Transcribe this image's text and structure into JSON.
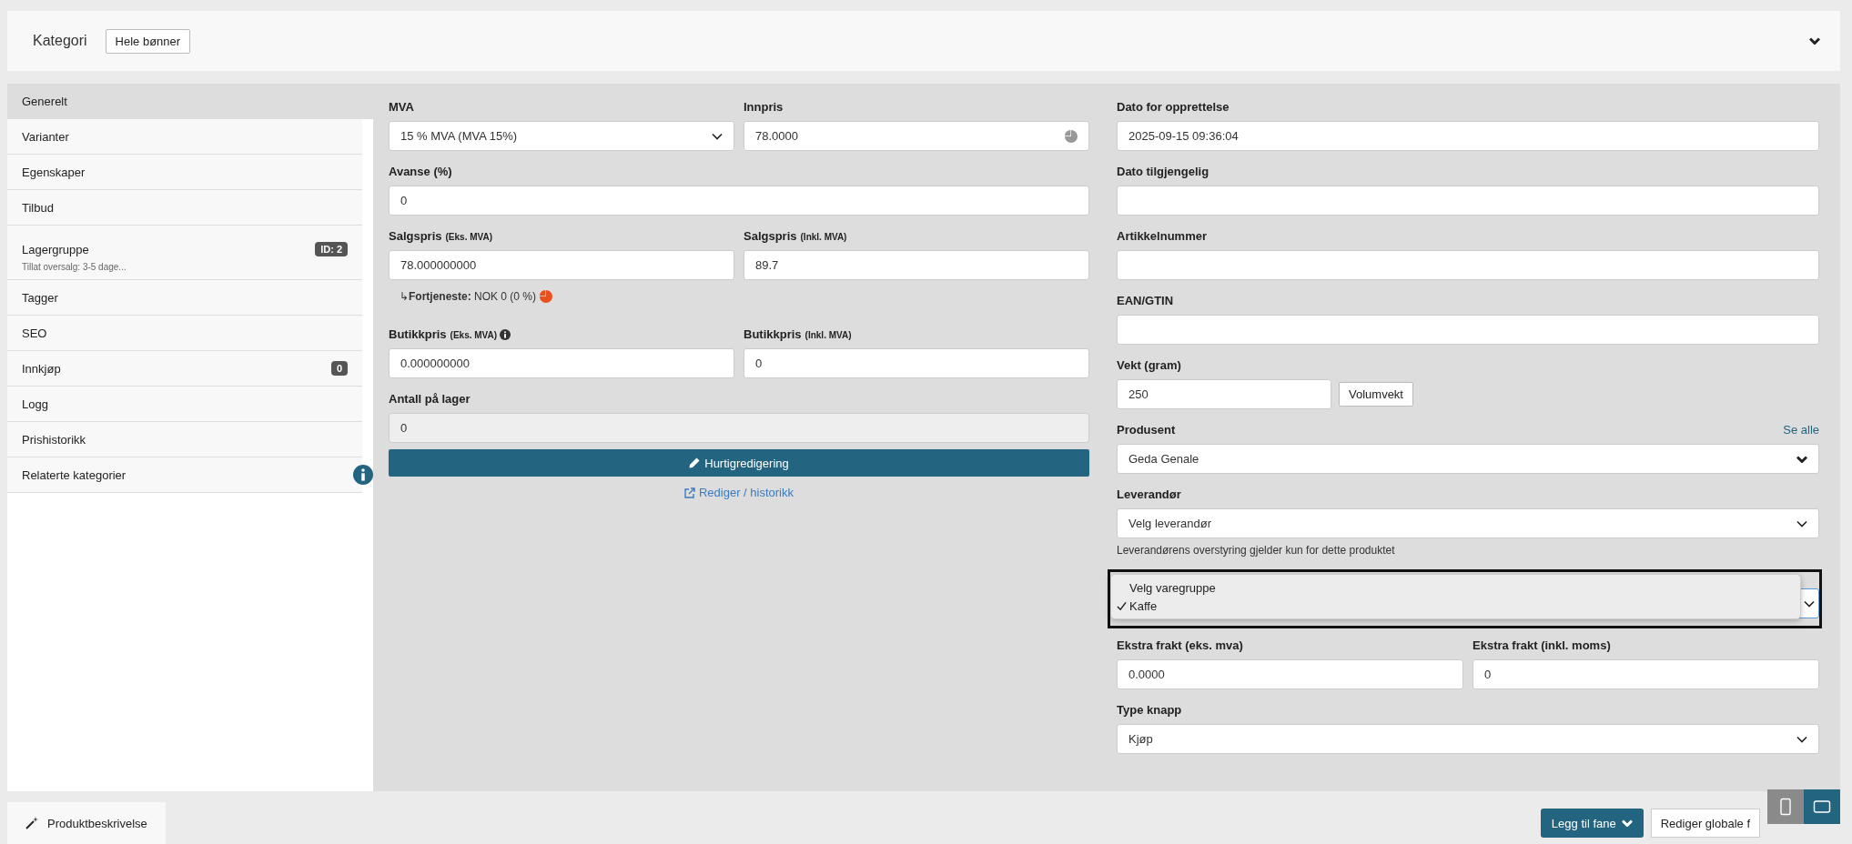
{
  "header": {
    "title": "Kategori",
    "button": "Hele bønner"
  },
  "sidebar": {
    "items": [
      {
        "label": "Generelt",
        "selected": true
      },
      {
        "label": "Varianter",
        "selected": false
      },
      {
        "label": "Egenskaper",
        "selected": false
      },
      {
        "label": "Tilbud",
        "selected": false
      },
      {
        "label": "Lagergruppe",
        "badge": "ID: 2",
        "note": "Tillat oversalg: 3-5 dage...",
        "selected": false
      },
      {
        "label": "Tagger",
        "selected": false
      },
      {
        "label": "SEO",
        "selected": false
      },
      {
        "label": "Innkjøp",
        "badge": "0",
        "selected": false
      },
      {
        "label": "Logg",
        "selected": false
      },
      {
        "label": "Prishistorikk",
        "selected": false
      },
      {
        "label": "Relaterte kategorier",
        "info": true,
        "selected": false
      }
    ]
  },
  "pricing": {
    "rows": [
      [
        {
          "label": "MVA",
          "kind": "select",
          "value": "15 % MVA (MVA 15%)"
        },
        {
          "label": "Innpris",
          "kind": "input-with-chart",
          "value": "78.0000"
        }
      ],
      [
        {
          "label": "Avanse (%)",
          "kind": "input",
          "value": "0"
        }
      ],
      [
        {
          "label": "Salgspris",
          "sub": "(Eks. MVA)",
          "kind": "input",
          "value": "78.000000000"
        },
        {
          "label": "Salgspris",
          "sub": "(Inkl. MVA)",
          "kind": "input",
          "value": "89.7"
        }
      ]
    ],
    "profit": "↳**Fortjeneste:** NOK 0 (0 %)",
    "rows2": [
      [
        {
          "label": "Butikkpris",
          "sub": "(Eks. MVA)",
          "info": true,
          "kind": "input",
          "value": "0.000000000"
        },
        {
          "label": "Butikkpris",
          "sub": "(Inkl. MVA)",
          "kind": "input",
          "value": "0"
        }
      ],
      [
        {
          "label": "Antall på lager",
          "kind": "input",
          "value": "0",
          "disabled": true
        }
      ]
    ],
    "quick_edit": "Hurtigredigering",
    "history_link": "Rediger / historikk"
  },
  "details": {
    "blocks": [
      {
        "kind": "input",
        "label": "Dato for opprettelse",
        "value": "2025-09-15 09:36:04"
      },
      {
        "kind": "input",
        "label": "Dato tilgjengelig"
      },
      {
        "kind": "input",
        "label": "Artikkelnummer"
      },
      {
        "kind": "input",
        "label": "EAN/GTIN"
      },
      {
        "kind": "input",
        "label": "Vekt (gram)",
        "value": "250",
        "button": "Volumvekt"
      },
      {
        "kind": "heavy-select",
        "label": "Produsent",
        "value": "Geda Genale",
        "link": "Se alle"
      },
      {
        "kind": "select",
        "label": "Leverandør",
        "value": "Velg leverandør",
        "help": "Leverandørens overstyring gjelder kun for dette produktet"
      },
      {
        "kind": "dropdown",
        "options": [
          {
            "label": "Velg varegruppe",
            "selected": false
          },
          {
            "label": "Kaffe",
            "selected": true
          }
        ]
      },
      {
        "kind": "pair",
        "fields": [
          {
            "label": "Ekstra frakt (eks. mva)",
            "kind": "input",
            "value": "0.0000"
          },
          {
            "label": "Ekstra frakt (inkl. moms)",
            "kind": "input",
            "value": "0"
          }
        ]
      },
      {
        "kind": "select",
        "label": "Type knapp",
        "value": "Kjøp"
      }
    ]
  },
  "footer": {
    "tabs": [
      {
        "label": "Produktbeskrivelse",
        "selected": true
      }
    ],
    "add_tab": "Legg til fane",
    "global": "Rediger globale f",
    "views": [
      {
        "kind": "phone",
        "selected": false
      },
      {
        "kind": "tablet",
        "selected": true
      }
    ]
  }
}
